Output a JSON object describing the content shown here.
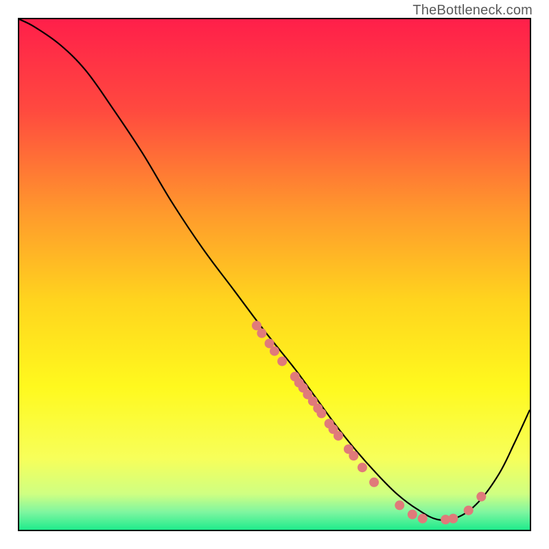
{
  "watermark": "TheBottleneck.com",
  "chart_data": {
    "type": "line",
    "title": "",
    "xlabel": "",
    "ylabel": "",
    "xlim": [
      0,
      1
    ],
    "ylim": [
      0,
      1
    ],
    "grid": false,
    "legend": false,
    "background_gradient_stops": [
      {
        "pos": 0.0,
        "color": "#ff1f4a"
      },
      {
        "pos": 0.18,
        "color": "#ff4a3f"
      },
      {
        "pos": 0.38,
        "color": "#ff9a2c"
      },
      {
        "pos": 0.55,
        "color": "#ffd41e"
      },
      {
        "pos": 0.72,
        "color": "#fff91e"
      },
      {
        "pos": 0.86,
        "color": "#f7ff5a"
      },
      {
        "pos": 0.93,
        "color": "#cfff82"
      },
      {
        "pos": 0.965,
        "color": "#7ff6a0"
      },
      {
        "pos": 1.0,
        "color": "#1feb8c"
      }
    ],
    "series": [
      {
        "name": "bottleneck-curve",
        "color": "#000000",
        "x": [
          0.0,
          0.03,
          0.08,
          0.13,
          0.18,
          0.24,
          0.3,
          0.36,
          0.42,
          0.48,
          0.54,
          0.58,
          0.62,
          0.66,
          0.7,
          0.74,
          0.78,
          0.82,
          0.86,
          0.9,
          0.94,
          0.97,
          1.0
        ],
        "y": [
          1.0,
          0.985,
          0.95,
          0.9,
          0.83,
          0.74,
          0.64,
          0.55,
          0.47,
          0.39,
          0.315,
          0.26,
          0.205,
          0.155,
          0.11,
          0.07,
          0.04,
          0.02,
          0.025,
          0.055,
          0.11,
          0.17,
          0.235
        ]
      }
    ],
    "scatter": {
      "name": "data-points",
      "color": "#e07a7a",
      "radius": 7,
      "points": [
        {
          "x": 0.465,
          "y": 0.4
        },
        {
          "x": 0.475,
          "y": 0.385
        },
        {
          "x": 0.49,
          "y": 0.365
        },
        {
          "x": 0.5,
          "y": 0.35
        },
        {
          "x": 0.515,
          "y": 0.33
        },
        {
          "x": 0.54,
          "y": 0.3
        },
        {
          "x": 0.548,
          "y": 0.288
        },
        {
          "x": 0.556,
          "y": 0.278
        },
        {
          "x": 0.565,
          "y": 0.265
        },
        {
          "x": 0.575,
          "y": 0.252
        },
        {
          "x": 0.585,
          "y": 0.238
        },
        {
          "x": 0.592,
          "y": 0.228
        },
        {
          "x": 0.607,
          "y": 0.208
        },
        {
          "x": 0.615,
          "y": 0.197
        },
        {
          "x": 0.625,
          "y": 0.184
        },
        {
          "x": 0.645,
          "y": 0.158
        },
        {
          "x": 0.655,
          "y": 0.145
        },
        {
          "x": 0.672,
          "y": 0.122
        },
        {
          "x": 0.695,
          "y": 0.093
        },
        {
          "x": 0.745,
          "y": 0.048
        },
        {
          "x": 0.77,
          "y": 0.03
        },
        {
          "x": 0.79,
          "y": 0.022
        },
        {
          "x": 0.835,
          "y": 0.02
        },
        {
          "x": 0.85,
          "y": 0.022
        },
        {
          "x": 0.88,
          "y": 0.038
        },
        {
          "x": 0.905,
          "y": 0.065
        }
      ]
    }
  }
}
